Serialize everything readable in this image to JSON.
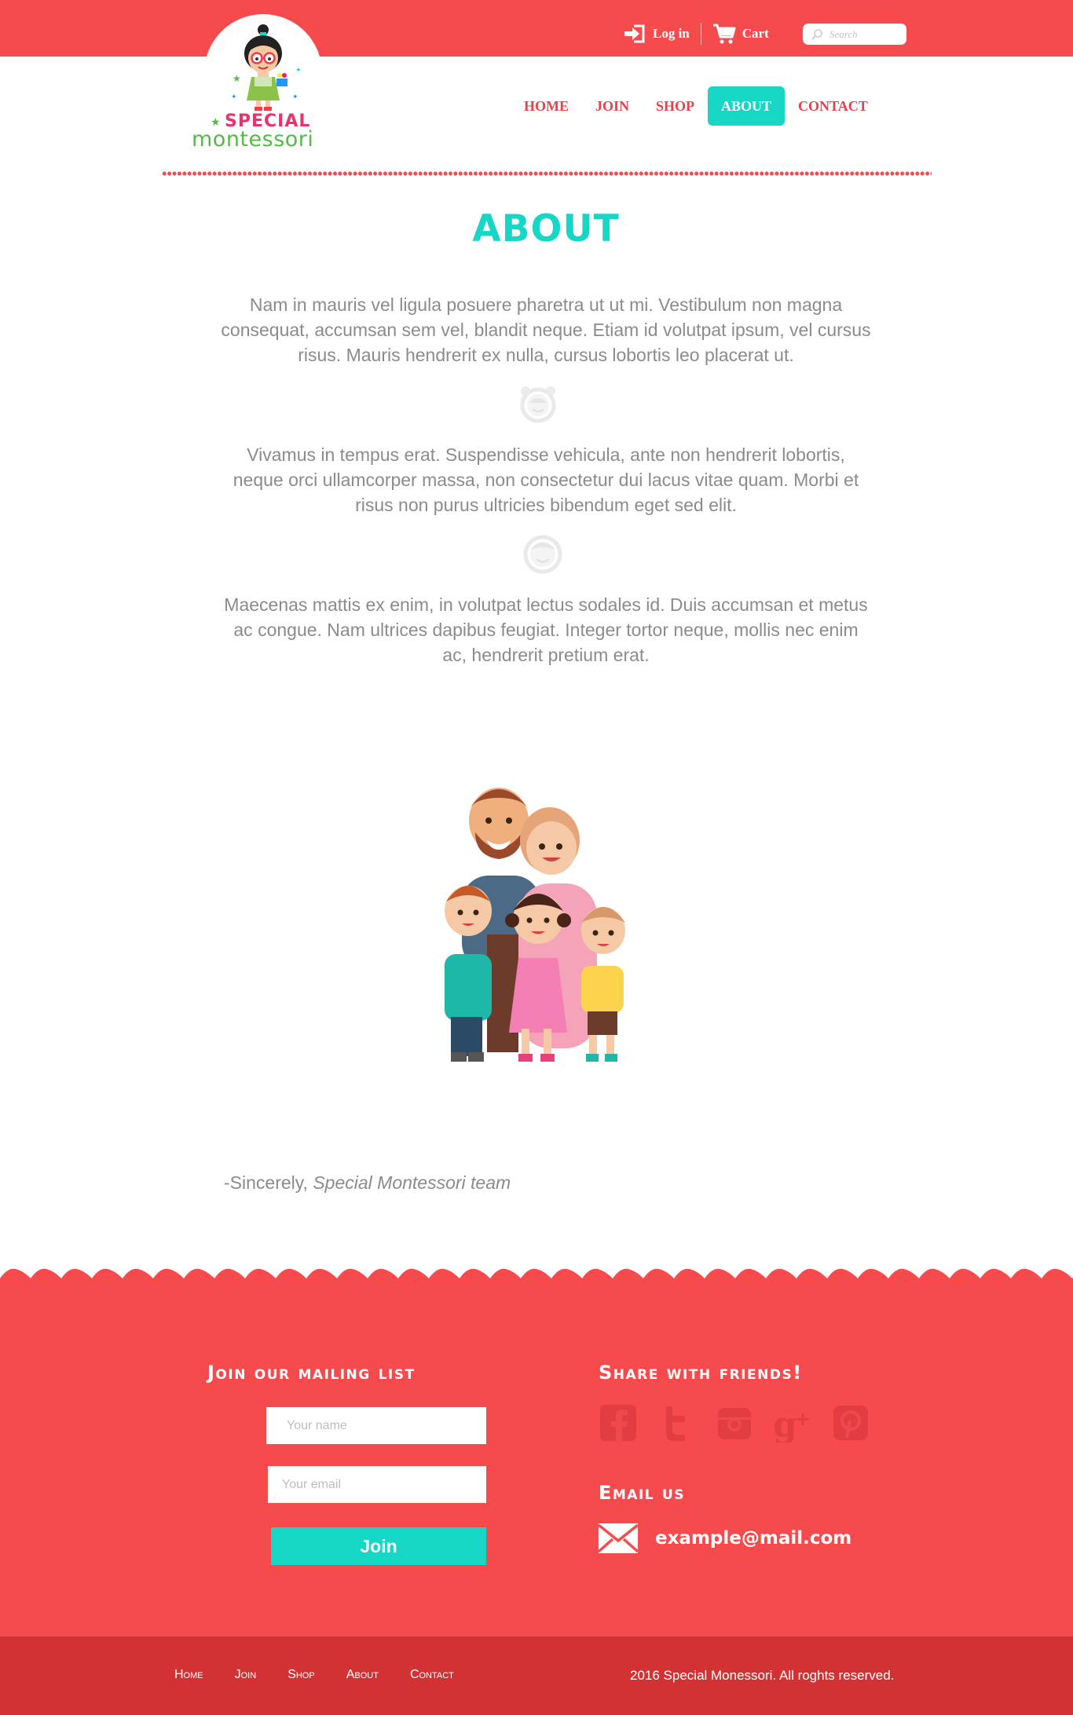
{
  "topbar": {
    "login_label": "Log in",
    "cart_label": "Cart",
    "search_placeholder": "Search"
  },
  "logo": {
    "word1": "SPECIAL",
    "word2": "montessori"
  },
  "nav": {
    "items": [
      {
        "label": "HOME"
      },
      {
        "label": "JOIN"
      },
      {
        "label": "SHOP"
      },
      {
        "label": "ABOUT"
      },
      {
        "label": "CONTACT"
      }
    ],
    "active_index": 3
  },
  "main": {
    "title": "ABOUT",
    "paragraphs": [
      "Nam in mauris vel ligula posuere pharetra ut ut mi. Vestibulum non magna consequat, accumsan sem vel, blandit neque. Etiam id volutpat ipsum, vel cursus risus. Mauris hendrerit ex nulla, cursus lobortis leo placerat ut.",
      "Vivamus in tempus erat. Suspendisse vehicula, ante non hendrerit lobortis, neque orci ullamcorper massa, non consectetur dui lacus vitae quam. Morbi et risus non purus ultricies bibendum eget sed elit.",
      "Maecenas mattis ex enim, in volutpat lectus sodales id. Duis accumsan et metus ac congue. Nam ultrices dapibus feugiat. Integer tortor neque, mollis nec enim ac, hendrerit pretium erat."
    ],
    "signoff_prefix": "-Sincerely, ",
    "signoff_team": "Special Montessori team"
  },
  "footer": {
    "mailing_heading": "Join our mailing list",
    "name_placeholder": "Your name",
    "email_placeholder": "Your email",
    "join_label": "Join",
    "share_heading": "Share with friends!",
    "social_icons": [
      "facebook-icon",
      "twitter-icon",
      "instagram-icon",
      "google-plus-icon",
      "pinterest-icon"
    ],
    "email_heading": "Email us",
    "email_address": "example@mail.com",
    "nav": [
      "Home",
      "Join",
      "Shop",
      "About",
      "Contact"
    ],
    "copyright": "2016 Special Monessori. All roghts reserved."
  },
  "colors": {
    "brand_red": "#f74a4c",
    "dark_red": "#d23234",
    "accent_teal": "#16d6c5",
    "body_text": "#8b8b8b"
  }
}
